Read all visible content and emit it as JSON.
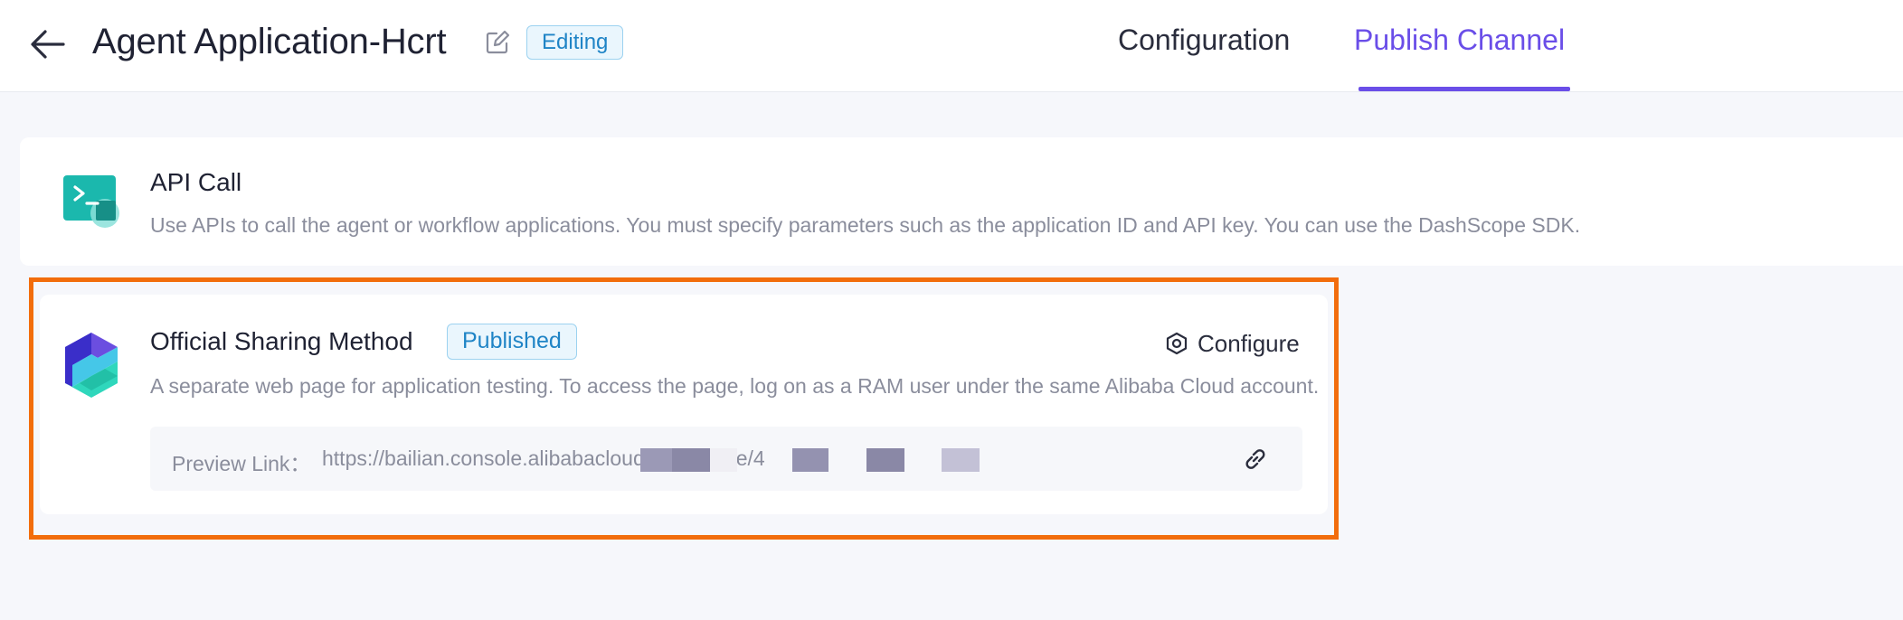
{
  "header": {
    "title": "Agent Application-Hcrt",
    "status_badge": "Editing",
    "tabs": [
      {
        "label": "Configuration",
        "active": false
      },
      {
        "label": "Publish Channel",
        "active": true
      }
    ]
  },
  "channels": {
    "api_call": {
      "title": "API Call",
      "description": "Use APIs to call the agent or workflow applications. You must specify parameters such as the application ID and API key. You can use the DashScope SDK.",
      "icon": "terminal-icon"
    },
    "official_sharing": {
      "title": "Official Sharing Method",
      "status_badge": "Published",
      "configure_label": "Configure",
      "description": "A separate web page for application testing. To access the page, log on as a RAM user under the same Alibaba Cloud account.",
      "preview_label": "Preview Link：",
      "preview_url": "https://bailian.console.alibabacloud.com/share/4",
      "icon": "bailian-logo-icon"
    }
  },
  "colors": {
    "accent": "#6a4ee8",
    "badge_text": "#1f84c6",
    "highlight": "#f26d0c",
    "api_icon": "#1bb8ad"
  }
}
